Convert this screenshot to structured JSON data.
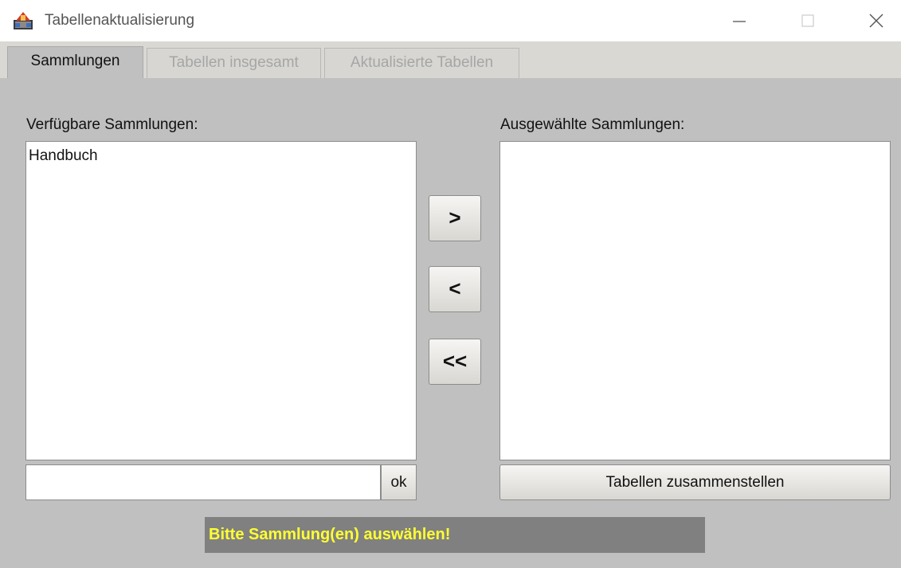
{
  "window": {
    "title": "Tabellenaktualisierung",
    "icon": "app-icon"
  },
  "tabs": [
    {
      "label": "Sammlungen",
      "active": true
    },
    {
      "label": "Tabellen insgesamt",
      "active": false
    },
    {
      "label": "Aktualisierte Tabellen",
      "active": false
    }
  ],
  "available": {
    "label": "Verfügbare Sammlungen:",
    "items": [
      "Handbuch"
    ]
  },
  "selected": {
    "label": "Ausgewählte Sammlungen:",
    "items": []
  },
  "buttons": {
    "add": ">",
    "remove": "<",
    "remove_all": "<<",
    "ok": "ok",
    "compile": "Tabellen zusammenstellen"
  },
  "search": {
    "value": ""
  },
  "status": {
    "message": "Bitte Sammlung(en) auswählen!",
    "text_color": "#ffff33",
    "background": "#808080"
  },
  "colors": {
    "panel": "#c0c0c0",
    "tabstrip": "#dad8d3"
  }
}
